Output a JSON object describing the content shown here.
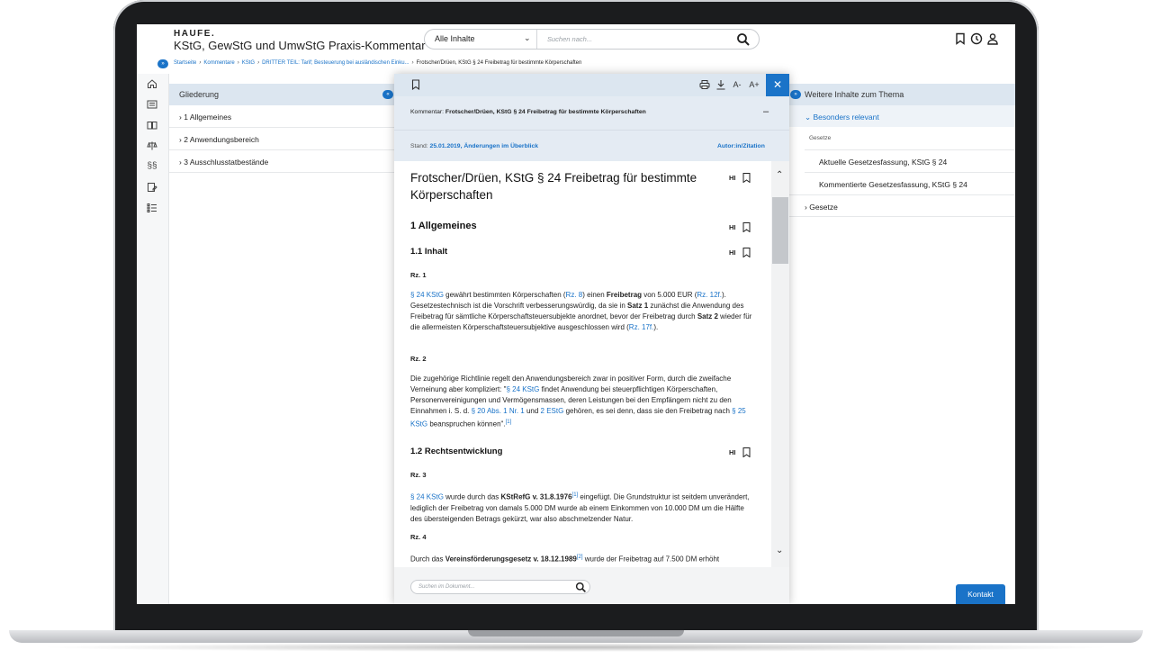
{
  "app": {
    "brand": "HAUFE.",
    "product_title": "KStG, GewStG und UmwStG Praxis-Kommentar"
  },
  "search": {
    "scope": "Alle Inhalte",
    "placeholder": "Suchen nach..."
  },
  "top_icons": [
    "bookmark-icon",
    "clock-icon",
    "user-icon"
  ],
  "breadcrumb": {
    "items": [
      "Startseite",
      "Kommentare",
      "KStG",
      "DRITTER TEIL: Tarif; Besteuerung bei ausländischen Einku..."
    ],
    "current": "Frotscher/Drüen, KStG § 24 Freibetrag für bestimmte Körperschaften"
  },
  "left_rail": [
    "home-icon",
    "news-icon",
    "book-icon",
    "scales-icon",
    "paragraph-icon",
    "forms-icon",
    "checklist-icon"
  ],
  "gliederung": {
    "title": "Gliederung",
    "items": [
      "1 Allgemeines",
      "2 Anwendungsbereich",
      "3 Ausschlusstatbestände"
    ]
  },
  "right_panel": {
    "title": "Weitere Inhalte zum Thema",
    "relevant": "Besonders relevant",
    "category": "Gesetze",
    "links": [
      "Aktuelle Gesetzesfassung, KStG § 24",
      "Kommentierte Gesetzesfassung, KStG § 24"
    ],
    "gesetze": "Gesetze"
  },
  "document": {
    "kommentar_label": "Kommentar:",
    "kommentar_title": "Frotscher/Drüen, KStG § 24 Freibetrag für bestimmte Körperschaften",
    "stand_label": "Stand:",
    "stand_date": "25.01.2019,",
    "stand_changes": "Änderungen im Überblick",
    "author_link": "Autor:in/Zitation",
    "title": "Frotscher/Drüen, KStG § 24 Freibetrag für bestimmte Körperschaften",
    "hl_label": "HI",
    "h1_allgemeines": "1 Allgemeines",
    "h2_inhalt": "1.1 Inhalt",
    "rz1": "Rz. 1",
    "p1": {
      "a1": "§ 24 KStG",
      "t1": " gewährt bestimmten Körperschaften (",
      "a2": "Rz. 8",
      "t2": ") einen ",
      "b1": "Freibetrag",
      "t3": " von 5.000 EUR (",
      "a3": "Rz. 12f.",
      "t4": "). Gesetzestechnisch ist die Vorschrift verbesserungswürdig, da sie in ",
      "b2": "Satz 1",
      "t5": " zunächst die Anwendung des Freibetrag für sämtliche Körperschaftsteuersubjekte anordnet, bevor der Freibetrag durch ",
      "b3": "Satz 2",
      "t6": " wieder für die allermeisten Körperschaftsteuersubjektive ausgeschlossen wird (",
      "a4": "Rz. 17f.",
      "t7": ")."
    },
    "rz2": "Rz. 2",
    "p2": {
      "t1": "Die zugehörige Richtlinie regelt den Anwendungsbereich zwar in positiver Form, durch die zweifache Verneinung aber kompliziert: \"",
      "a1": "§ 24 KStG",
      "t2": " findet Anwendung bei steuerpflichtigen Körperschaften, Personenvereinigungen und Vermögensmassen, deren Leistungen bei den Empfängern nicht zu den Einnahmen i. S. d. ",
      "a2": "§ 20 Abs. 1 Nr. 1",
      "t3": " und ",
      "a3": "2 EStG",
      "t4": " gehören, es sei denn, dass sie den Freibetrag nach ",
      "a4": "§ 25 KStG",
      "t5": " beanspruchen können\".",
      "s1": "[1]"
    },
    "h2_rechtsentwicklung": "1.2 Rechtsentwicklung",
    "rz3": "Rz. 3",
    "p3": {
      "a1": "§ 24 KStG",
      "t1": " wurde durch das ",
      "b1": "KStRefG v. 31.8.1976",
      "s1": "[1]",
      "t2": " eingefügt. Die Grundstruktur ist seitdem unverändert, lediglich der Freibetrag von damals 5.000 DM wurde ab einem Einkommen von 10.000 DM um die Hälfte des übersteigenden Betrags gekürzt, war also abschmelzender Natur."
    },
    "rz4": "Rz. 4",
    "p4": {
      "t1": "Durch das ",
      "b1": "Vereinsförderungsgesetz v. 18.12.1989",
      "s1": "[2]",
      "t2": " wurde der Freibetrag auf 7.500 DM erhöht"
    },
    "footer_search_placeholder": "Suchen im Dokument..."
  },
  "kontakt_label": "Kontakt",
  "colors": {
    "accent": "#1a73c8",
    "panel_header": "#dce6f0",
    "meta_bg": "#e4ebf3"
  }
}
